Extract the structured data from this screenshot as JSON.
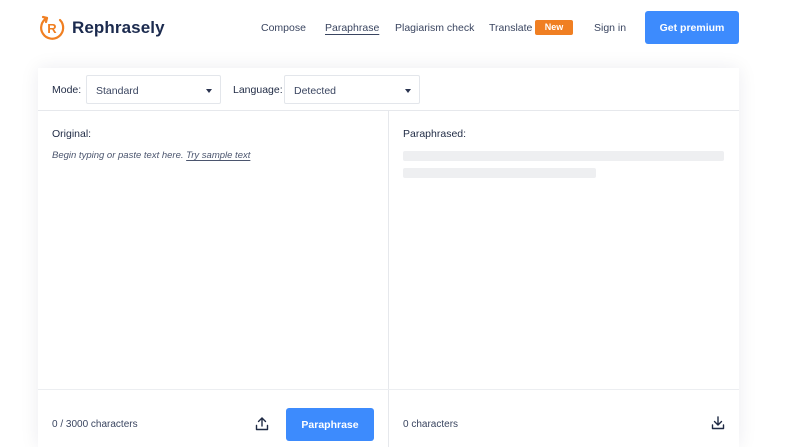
{
  "brand": {
    "name": "Rephrasely",
    "logo_letter": "R",
    "color": "#f07f22"
  },
  "nav": {
    "items": [
      {
        "label": "Compose"
      },
      {
        "label": "Paraphrase",
        "active": true
      },
      {
        "label": "Plagiarism check"
      },
      {
        "label": "Translate"
      }
    ],
    "new_badge": "New",
    "sign_in": "Sign in",
    "premium_button": "Get premium"
  },
  "toolbar": {
    "mode_label": "Mode:",
    "mode_value": "Standard",
    "language_label": "Language:",
    "language_value": "Detected"
  },
  "original": {
    "title": "Original:",
    "placeholder": "Begin typing or paste text here.",
    "sample_link": "Try sample text",
    "char_count": "0 / 3000 characters",
    "upload_icon": "upload-icon",
    "paraphrase_button": "Paraphrase"
  },
  "paraphrased": {
    "title": "Paraphrased:",
    "char_count": "0 characters",
    "download_icon": "download-icon"
  },
  "colors": {
    "accent": "#3d8bfd",
    "badge": "#f07f22",
    "text": "#1f2a44"
  }
}
